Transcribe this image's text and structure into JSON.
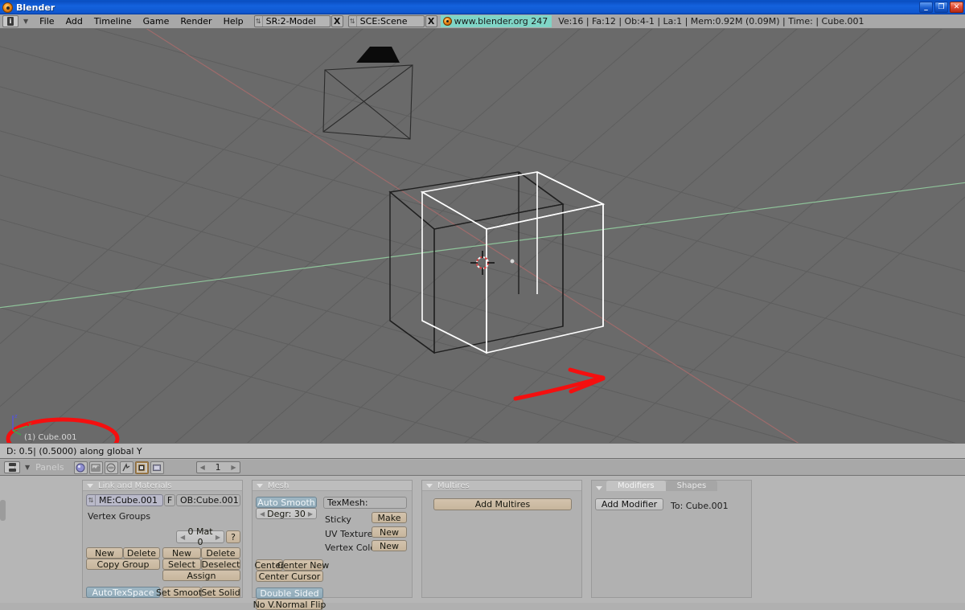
{
  "window": {
    "title": "Blender",
    "logo_icon": "blender-logo-icon",
    "minimize_label": "_",
    "restore_label": "❐",
    "close_label": "✕"
  },
  "header": {
    "window_type_icon": "info-window-type-icon",
    "menu_caret_icon": "collapse-caret-icon",
    "menus": [
      "File",
      "Add",
      "Timeline",
      "Game",
      "Render",
      "Help"
    ],
    "screen_field": {
      "icon": "browse-screen-icon",
      "value": "SR:2-Model",
      "delete_label": "X"
    },
    "scene_field": {
      "icon": "browse-scene-icon",
      "value": "SCE:Scene",
      "delete_label": "X"
    },
    "weblink": {
      "icon": "blender-logo-icon",
      "label": "www.blender.org 247"
    },
    "stats": "Ve:16 | Fa:12 | Ob:4-1 | La:1 | Mem:0.92M (0.09M) | Time: | Cube.001"
  },
  "viewport": {
    "object_label": "(1) Cube.001",
    "axis_gizmo": {
      "z_label": "z",
      "y_label": "y"
    },
    "background_color": "#6a6a6a",
    "grid_color": "#5e5e5e",
    "x_axis_color": "#9e6b6b",
    "y_axis_color": "#8fc49a",
    "selected_wire_color": "#ffffff",
    "unselected_wire_color": "#1f1f1f",
    "annotation_color": "#f40f0f"
  },
  "statusline": {
    "text": "D: 0.5| (0.5000) along global Y"
  },
  "buttons_header": {
    "window_type_icon": "buttons-window-type-icon",
    "menu_caret_icon": "collapse-caret-icon",
    "panels_label": "Panels",
    "tabs": [
      {
        "icon": "shading-tab-icon",
        "active": false
      },
      {
        "icon": "object-tab-icon",
        "active": false
      },
      {
        "icon": "world-tab-icon",
        "active": false
      },
      {
        "icon": "physics-tab-icon",
        "active": false
      },
      {
        "icon": "editing-tab-icon",
        "active": true
      },
      {
        "icon": "scene-tab-icon",
        "active": false
      }
    ],
    "frame_field": {
      "value": "1",
      "prev_icon": "left-arrow-icon",
      "next_icon": "right-arrow-icon"
    }
  },
  "panels": {
    "link_materials": {
      "title": "Link and Materials",
      "mesh_field": {
        "icon": "browse-mesh-icon",
        "value": "ME:Cube.001"
      },
      "fake_user_label": "F",
      "object_field": {
        "value": "OB:Cube.001"
      },
      "vertex_groups_label": "Vertex Groups",
      "material_index": {
        "value": "0 Mat 0",
        "prev_icon": "left-arrow-icon",
        "next_icon": "right-arrow-icon"
      },
      "help_label": "?",
      "vg_new": "New",
      "vg_delete": "Delete",
      "copy_group": "Copy Group",
      "mat_new": "New",
      "mat_delete": "Delete",
      "mat_select": "Select",
      "mat_deselect": "Deselect",
      "mat_assign": "Assign",
      "autotexspace": "AutoTexSpace",
      "set_smooth": "Set Smooth",
      "set_solid": "Set Solid"
    },
    "mesh": {
      "title": "Mesh",
      "auto_smooth": "Auto Smooth",
      "degr": {
        "value": "Degr: 30",
        "prev_icon": "left-arrow-icon",
        "next_icon": "right-arrow-icon"
      },
      "texmesh": "TexMesh:",
      "sticky_label": "Sticky",
      "sticky_button": "Make",
      "uv_texture_label": "UV Texture",
      "uv_texture_button": "New",
      "vertex_color_label": "Vertex Color",
      "vertex_color_button": "New",
      "center": "Center",
      "center_new": "Center New",
      "center_cursor": "Center Cursor",
      "double_sided": "Double Sided",
      "no_vnormal_flip": "No V.Normal Flip"
    },
    "multires": {
      "title": "Multires",
      "add_multires": "Add Multires"
    },
    "modifiers": {
      "tab_modifiers": "Modifiers",
      "tab_shapes": "Shapes",
      "add_modifier": "Add Modifier",
      "target_label": "To: Cube.001"
    }
  }
}
